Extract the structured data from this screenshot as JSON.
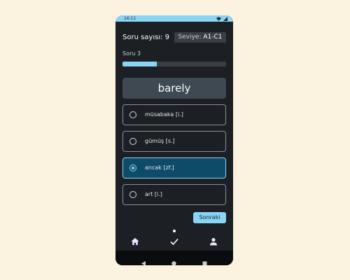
{
  "status_bar": {
    "time": "16:11",
    "icons": [
      "wifi-icon",
      "signal-icon"
    ]
  },
  "header": {
    "count_label": "Soru sayısı: 9",
    "level_key": "Seviye:",
    "level_value": "A1-C1"
  },
  "question": {
    "label": "Soru 3",
    "progress": 0.33
  },
  "word": "barely",
  "options": [
    {
      "label": "müsabaka [i.]",
      "selected": false
    },
    {
      "label": "gümüş [s.]",
      "selected": false
    },
    {
      "label": "ancak [zf.]",
      "selected": true
    },
    {
      "label": "art [i.]",
      "selected": false
    }
  ],
  "next_button": "Sonraki",
  "bottom_nav": {
    "items": [
      "home-icon",
      "check-icon",
      "person-icon"
    ],
    "active": 1
  },
  "colors": {
    "accent": "#8ad4f5",
    "surface": "#1c1f23",
    "selected": "#0d4b68",
    "page_bg": "#fbf3df"
  }
}
